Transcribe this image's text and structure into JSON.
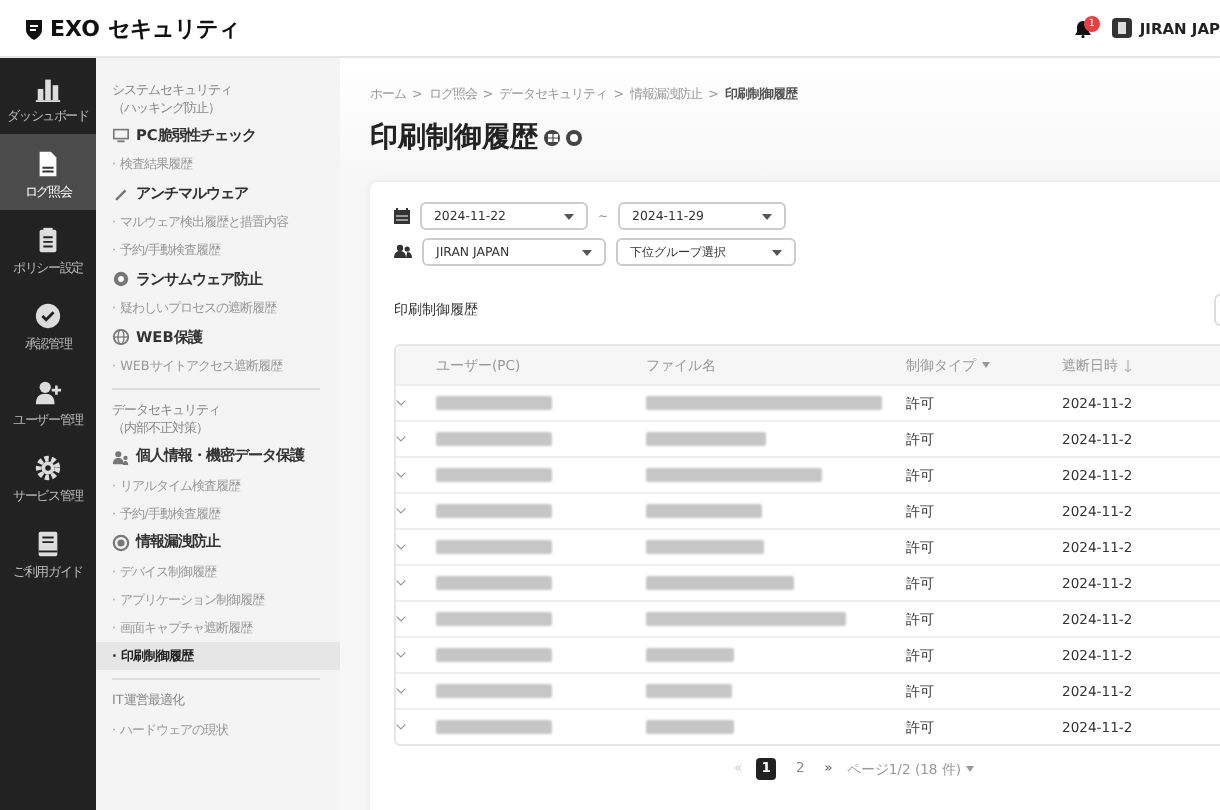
{
  "header": {
    "logo": "EXO セキュリティ",
    "notification_count": "1",
    "account": "JIRAN JAP"
  },
  "nav": [
    {
      "label": "ダッシュボード",
      "selected": false
    },
    {
      "label": "ログ照会",
      "selected": true
    },
    {
      "label": "ポリシー設定",
      "selected": false
    },
    {
      "label": "承認管理",
      "selected": false
    },
    {
      "label": "ユーザー管理",
      "selected": false
    },
    {
      "label": "サービス管理",
      "selected": false
    },
    {
      "label": "ご利用ガイド",
      "selected": false
    }
  ],
  "submenu": [
    {
      "title": "システムセキュリティ",
      "subtitle": "（ハッキング防止）",
      "groups": [
        {
          "label": "PC脆弱性チェック",
          "items": [
            {
              "label": "· 検査結果履歴",
              "selected": false
            }
          ]
        },
        {
          "label": "アンチマルウェア",
          "items": [
            {
              "label": "· マルウェア検出履歴と措置内容",
              "selected": false
            },
            {
              "label": "· 予約/手動検査履歴",
              "selected": false
            }
          ]
        },
        {
          "label": "ランサムウェア防止",
          "items": [
            {
              "label": "· 疑わしいプロセスの遮断履歴",
              "selected": false
            }
          ]
        },
        {
          "label": "WEB保護",
          "items": [
            {
              "label": "· WEBサイトアクセス遮断履歴",
              "selected": false
            }
          ]
        }
      ]
    },
    {
      "title": "データセキュリティ",
      "subtitle": "（内部不正対策）",
      "groups": [
        {
          "label": "個人情報・機密データ保護",
          "items": [
            {
              "label": "· リアルタイム検査履歴",
              "selected": false
            },
            {
              "label": "· 予約/手動検査履歴",
              "selected": false
            }
          ]
        },
        {
          "label": "情報漏洩防止",
          "items": [
            {
              "label": "· デバイス制御履歴",
              "selected": false
            },
            {
              "label": "· アプリケーション制御履歴",
              "selected": false
            },
            {
              "label": "· 画面キャプチャ遮断履歴",
              "selected": false
            },
            {
              "label": "· 印刷制御履歴",
              "selected": true
            }
          ]
        }
      ]
    },
    {
      "title": "IT運営最適化",
      "items": [
        {
          "label": "· ハードウェアの現状",
          "selected": false
        }
      ]
    }
  ],
  "main": {
    "breadcrumb": [
      "ホーム",
      "ログ照会",
      "データセキュリティ",
      "情報漏洩防止",
      "印刷制御履歴"
    ],
    "breadcrumb_separator": ">",
    "title": "印刷制御履歴",
    "filters": {
      "date_from": "2024-11-22",
      "range_separator": "~",
      "date_to": "2024-11-29",
      "group": "JIRAN JAPAN",
      "subgroup": "下位グループ選択"
    },
    "section_title": "印刷制御履歴",
    "table": {
      "columns": [
        "ユーザー(PC)",
        "ファイル名",
        "制御タイプ",
        "遮断日時"
      ],
      "rows": [
        {
          "control_type": "許可",
          "datetime": "2024-11-2"
        },
        {
          "control_type": "許可",
          "datetime": "2024-11-2"
        },
        {
          "control_type": "許可",
          "datetime": "2024-11-2"
        },
        {
          "control_type": "許可",
          "datetime": "2024-11-2"
        },
        {
          "control_type": "許可",
          "datetime": "2024-11-2"
        },
        {
          "control_type": "許可",
          "datetime": "2024-11-2"
        },
        {
          "control_type": "許可",
          "datetime": "2024-11-2"
        },
        {
          "control_type": "許可",
          "datetime": "2024-11-2"
        },
        {
          "control_type": "許可",
          "datetime": "2024-11-2"
        },
        {
          "control_type": "許可",
          "datetime": "2024-11-2"
        }
      ]
    },
    "pagination": {
      "previous": {
        "label": "«",
        "disabled": true
      },
      "pages": [
        {
          "label": "1",
          "selected": true
        },
        {
          "label": "2",
          "selected": false
        }
      ],
      "next": {
        "label": "»",
        "disabled": false
      },
      "summary": "ページ1/2 (18 件)"
    }
  }
}
